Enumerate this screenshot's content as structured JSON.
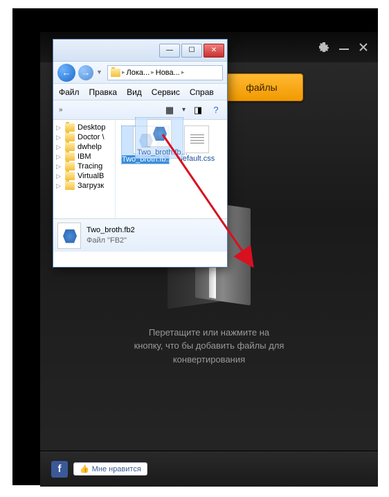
{
  "app": {
    "add_files_label": "файлы",
    "drop_line1": "Перетащите или нажмите на",
    "drop_line2": "кнопку, что бы добавить файлы для",
    "drop_line3": "конвертирования",
    "like_label": "Мне нравится",
    "fb_glyph": "f"
  },
  "explorer": {
    "breadcrumb": {
      "part1": "Лока...",
      "part2": "Нова...",
      "sep": "▸"
    },
    "menu": {
      "file": "Файл",
      "edit": "Правка",
      "view": "Вид",
      "service": "Сервис",
      "help": "Справ"
    },
    "toolbar": {
      "chevron": "»"
    },
    "tree": [
      {
        "label": "Desktop"
      },
      {
        "label": "Doctor \\"
      },
      {
        "label": "dwhelp"
      },
      {
        "label": "IBM"
      },
      {
        "label": "Tracing"
      },
      {
        "label": "VirtualB"
      },
      {
        "label": "Загрузк"
      }
    ],
    "files": {
      "selected": {
        "name": "Two_broth.fb2",
        "short": "Two_broth.fb..."
      },
      "other": {
        "name": "default.css"
      }
    },
    "detail": {
      "name": "Two_broth.fb2",
      "type": "Файл \"FB2\""
    }
  },
  "win_controls": {
    "min": "—",
    "max": "☐",
    "close": "✕"
  }
}
